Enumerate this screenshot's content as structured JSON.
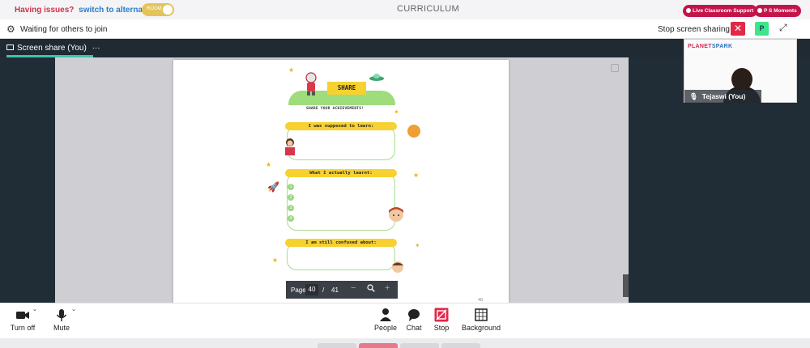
{
  "topbar": {
    "issues_text": "Having issues?",
    "alt_link": "switch to alternate room",
    "room_toggle": "ROOM",
    "title": "CURRICULUM",
    "support_btn": "Live Classroom Support",
    "moments_btn": "P S Moments"
  },
  "toolbar": {
    "waiting": "Waiting for others to join",
    "stop_sharing": "Stop screen sharing",
    "close_symbol": "✕",
    "participant_initial": "P"
  },
  "share_tab": {
    "label": "Screen share (You)",
    "more": "···"
  },
  "video_tile": {
    "brand_a": "PLANET",
    "brand_b": "SPARK",
    "name": "Tejaswi (You)"
  },
  "document": {
    "header": "SHARE",
    "subtitle": "SHARE YOUR ACHIEVEMENTS!",
    "sections": [
      "I was supposed to learn:",
      "What I actually learnt:",
      "I am still confused about:"
    ],
    "numbers": [
      "1",
      "2",
      "3",
      "4"
    ],
    "page_number": "40"
  },
  "page_nav": {
    "label": "Page",
    "current": "40",
    "separator": "/",
    "total": "41",
    "minus": "−",
    "plus": "+"
  },
  "controls": {
    "camera": "Turn off",
    "mic": "Mute",
    "people": "People",
    "chat": "Chat",
    "stop": "Stop",
    "background": "Background"
  },
  "colors": {
    "accent_red": "#e22747",
    "teal": "#3fc3a8",
    "dark": "#202d37",
    "yellow": "#f6d130"
  }
}
